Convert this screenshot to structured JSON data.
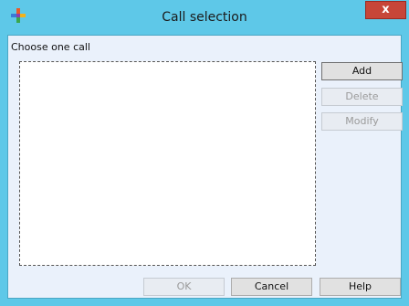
{
  "window": {
    "title": "Call selection",
    "close_label": "x"
  },
  "main": {
    "prompt": "Choose one call",
    "list_items": []
  },
  "side_buttons": {
    "add": "Add",
    "delete": "Delete",
    "modify": "Modify"
  },
  "footer_buttons": {
    "ok": "OK",
    "cancel": "Cancel",
    "help": "Help"
  },
  "colors": {
    "frame": "#5ec8e8",
    "client_bg": "#eaf1fb",
    "close_button": "#c74638"
  }
}
